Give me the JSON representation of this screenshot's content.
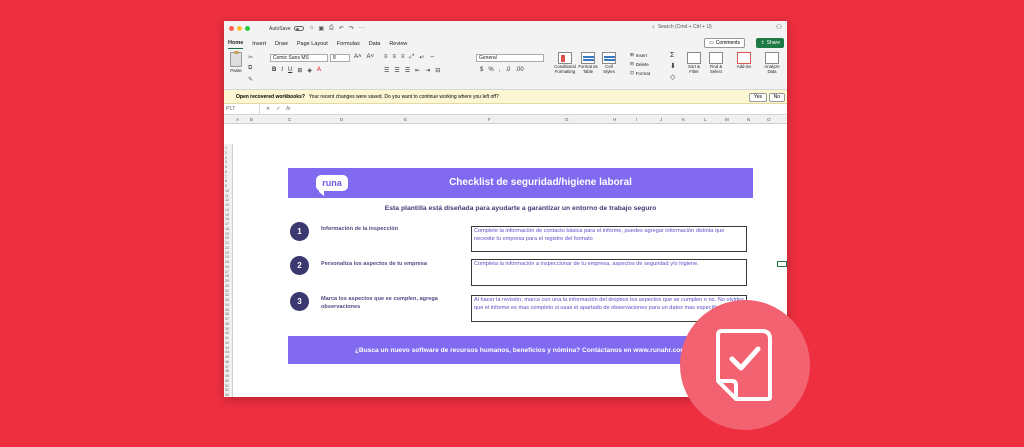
{
  "window": {
    "autosave_label": "AutoSave",
    "search_placeholder": "Search (Cmd + Ctrl + U)"
  },
  "ribbon": {
    "tabs": [
      "Home",
      "Insert",
      "Draw",
      "Page Layout",
      "Formulas",
      "Data",
      "Review"
    ],
    "comments_label": "Comments",
    "share_label": "Share",
    "paste_label": "Paste",
    "font_name": "Comic Sans MS",
    "font_size": "8",
    "number_format": "General",
    "conditional_formatting": "Conditional Formatting",
    "format_as_table": "Format as Table",
    "cell_styles": "Cell Styles",
    "insert_label": "Insert",
    "delete_label": "Delete",
    "format_label": "Format",
    "sort_filter": "Sort & Filter",
    "find_select": "Find & Select",
    "addins_label": "Add-ins",
    "analyze_data": "Analyze Data"
  },
  "infobar": {
    "title": "Open recovered workbooks?",
    "message": "Your recent changes were saved. Do you want to continue working where you left off?",
    "yes": "Yes",
    "no": "No"
  },
  "formula_bar": {
    "cell_ref": "P17"
  },
  "columns": [
    "A",
    "B",
    "C",
    "D",
    "E",
    "F",
    "G",
    "H",
    "I",
    "J",
    "K",
    "L",
    "M",
    "N",
    "O"
  ],
  "template": {
    "logo": "runa",
    "title": "Checklist de seguridad/higiene laboral",
    "subtitle": "Esta plantilla está diseñada para ayudarte a garantizar un entorno de trabajo seguro",
    "steps": [
      {
        "number": "1",
        "label": "Información de la inspección",
        "text": "Complete la información de contacto básica para el informe, puedes agregar información distinta que necesite tu empresa para el registro del formato"
      },
      {
        "number": "2",
        "label": "Personaliza los aspectos de tu empresa",
        "text": "Completa la información a inspeccionar de tu empresa, aspectos de seguridad y/o higiene."
      },
      {
        "number": "3",
        "label": "Marca los aspectos que se cumplen, agrega observaciones",
        "text": "Al hacer la revisión, marca con una la información del dropbox los aspectos que se cumplen o no. No olvides que el informe es mas completo si usas el apartado de observaciones para un datos mas específicos."
      }
    ],
    "footer": "¿Busca un nuevo software de recursos humanos, beneficios y nómina? Contáctanos en www.runahr.com"
  },
  "colors": {
    "background": "#ee2f40",
    "accent_purple": "#8169f0",
    "step_circle": "#3b3870",
    "overlay_circle": "#f26270"
  },
  "icons": {
    "overlay": "document-check-icon"
  }
}
